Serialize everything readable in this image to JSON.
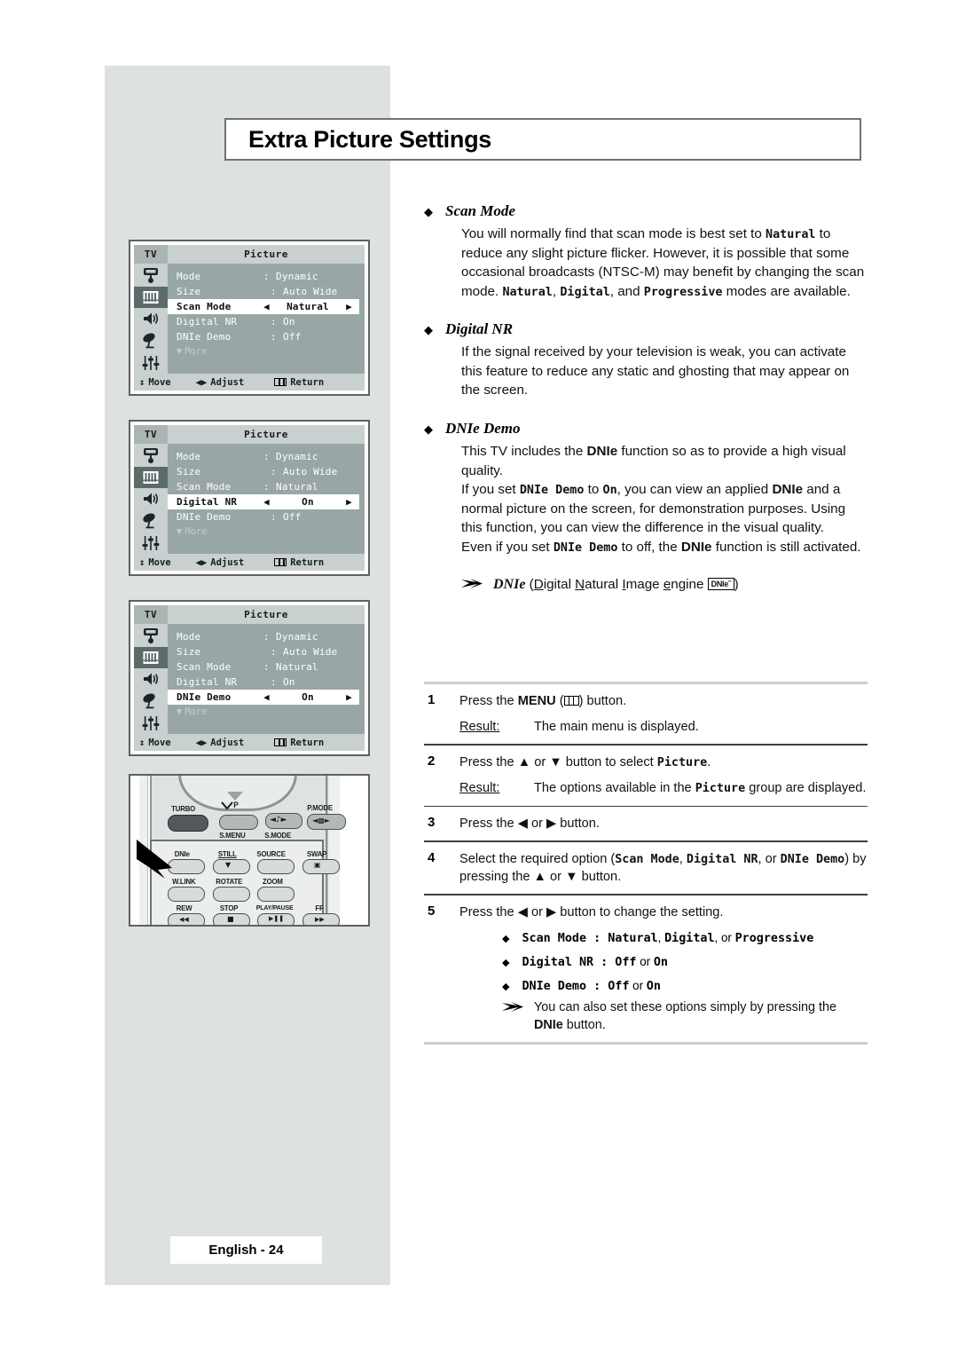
{
  "page": {
    "title": "Extra Picture Settings",
    "footer": "English - 24"
  },
  "osd_menus": [
    {
      "tv_label": "TV",
      "title": "Picture",
      "more_label": "More",
      "rows": [
        {
          "label": "Mode",
          "colon": ":",
          "value": "Dynamic",
          "highlight": false
        },
        {
          "label": "Size",
          "colon": ":",
          "value": "Auto Wide",
          "highlight": false
        },
        {
          "label": "Scan Mode",
          "colon": "",
          "value": "Natural",
          "highlight": true
        },
        {
          "label": "Digital NR",
          "colon": ":",
          "value": "On",
          "highlight": false
        },
        {
          "label": "DNIe Demo",
          "colon": ":",
          "value": "Off",
          "highlight": false
        }
      ],
      "footer": {
        "move": "Move",
        "adjust": "Adjust",
        "return": "Return"
      }
    },
    {
      "tv_label": "TV",
      "title": "Picture",
      "more_label": "More",
      "rows": [
        {
          "label": "Mode",
          "colon": ":",
          "value": "Dynamic",
          "highlight": false
        },
        {
          "label": "Size",
          "colon": ":",
          "value": "Auto Wide",
          "highlight": false
        },
        {
          "label": "Scan Mode",
          "colon": ":",
          "value": "Natural",
          "highlight": false
        },
        {
          "label": "Digital NR",
          "colon": "",
          "value": "On",
          "highlight": true
        },
        {
          "label": "DNIe Demo",
          "colon": ":",
          "value": "Off",
          "highlight": false
        }
      ],
      "footer": {
        "move": "Move",
        "adjust": "Adjust",
        "return": "Return"
      }
    },
    {
      "tv_label": "TV",
      "title": "Picture",
      "more_label": "More",
      "rows": [
        {
          "label": "Mode",
          "colon": ":",
          "value": "Dynamic",
          "highlight": false
        },
        {
          "label": "Size",
          "colon": ":",
          "value": "Auto Wide",
          "highlight": false
        },
        {
          "label": "Scan Mode",
          "colon": ":",
          "value": "Natural",
          "highlight": false
        },
        {
          "label": "Digital NR",
          "colon": ":",
          "value": "On",
          "highlight": false
        },
        {
          "label": "DNIe Demo",
          "colon": "",
          "value": "On",
          "highlight": true
        }
      ],
      "footer": {
        "move": "Move",
        "adjust": "Adjust",
        "return": "Return"
      }
    }
  ],
  "remote": {
    "labels": {
      "turbo": "TURBO",
      "vp": "P",
      "smenu": "S.MENU",
      "smode": "S.MODE",
      "pmode": "P.MODE",
      "dnie": "DNIe",
      "still": "STILL",
      "source": "SOURCE",
      "swap": "SWAP",
      "wlink": "W.LINK",
      "rotate": "ROTATE",
      "zoom": "ZOOM",
      "rew": "REW",
      "stop": "STOP",
      "play_pause": "PLAY/PAUSE",
      "ff": "FF"
    }
  },
  "sections": [
    {
      "heading": "Scan Mode",
      "body_html": "You will normally find that scan mode is best set to <span class=\"mono\">Natural</span> to reduce any slight picture flicker. However, it is possible that some occasional broadcasts (NTSC-M) may benefit by changing the scan mode. <span class=\"mono\">Natural</span>, <span class=\"mono\">Digital</span>, and <span class=\"mono\">Progressive</span> modes are available."
    },
    {
      "heading": "Digital NR",
      "body_html": "If the signal received by your television is weak, you can activate this feature to reduce any static and ghosting that may appear on the screen."
    },
    {
      "heading": "DNIe Demo",
      "body_html": "This TV includes the <span class=\"sb\">DNIe</span> function so as to provide a high visual quality.<br>If you set <span class=\"mono\">DNIe&nbsp;Demo</span> to <span class=\"mono\">On</span>, you can view an applied <span class=\"sb\">DNIe</span> and a normal picture on the screen, for demonstration purposes. Using this function, you can view the difference in the visual quality.<br>Even if you set <span class=\"mono\">DNIe&nbsp;Demo</span> to off, the <span class=\"sb\">DNIe</span> function is still activated."
    }
  ],
  "dnie_note": {
    "name": "DNIe",
    "expansion_html": "(<span class=\"ul\">D</span>igital <span class=\"ul\">N</span>atural <span class=\"ul\">I</span>mage <span class=\"ul\">e</span>ngine ",
    "logo": "DNIe˜",
    "close": ")"
  },
  "steps": [
    {
      "num": "1",
      "line_html": "Press the <span class=\"sb\">MENU</span> (<span class=\"menu-glyph\"></span>) button.",
      "results": [
        {
          "label": "Result:",
          "text_html": "The main menu is displayed."
        }
      ]
    },
    {
      "num": "2",
      "line_html": "Press the ▲ or ▼ button to select <span class=\"mono\">Picture</span>.",
      "results": [
        {
          "label": "Result:",
          "text_html": "The options available in the <span class=\"mono\">Picture</span> group are displayed."
        }
      ]
    },
    {
      "num": "3",
      "line_html": "Press the ◀ or ▶ button.",
      "results": []
    },
    {
      "num": "4",
      "line_html": "Select the required option (<span class=\"mono\">Scan&nbsp;Mode</span>, <span class=\"mono\">Digital&nbsp;NR</span>, or <span class=\"mono\">DNIe Demo</span>) by pressing the ▲ or ▼ button.",
      "results": []
    },
    {
      "num": "5",
      "line_html": "Press the ◀ or ▶ button to change the setting.",
      "results": [],
      "options": [
        "<span class=\"mono\">Scan&nbsp;Mode&nbsp;:&nbsp;Natural</span>, <span class=\"mono\">Digital</span>, or <span class=\"mono\">Progressive</span>",
        "<span class=\"mono\">Digital&nbsp;NR&nbsp;:&nbsp;Off</span> or <span class=\"mono\">On</span>",
        "<span class=\"mono\">DNIe&nbsp;Demo&nbsp;:&nbsp;Off</span> or <span class=\"mono\">On</span>"
      ],
      "note_html": "You can also set these options simply by pressing the <span class=\"sb\">DNIe</span> button."
    }
  ],
  "colors": {
    "panel_gray": "#dde1e1",
    "osd_body": "#99a6a6",
    "osd_bar": "#c8d0d0",
    "osd_rail_active": "#5c6a6a",
    "border": "#5d6360",
    "rule": "#3a3f40"
  }
}
